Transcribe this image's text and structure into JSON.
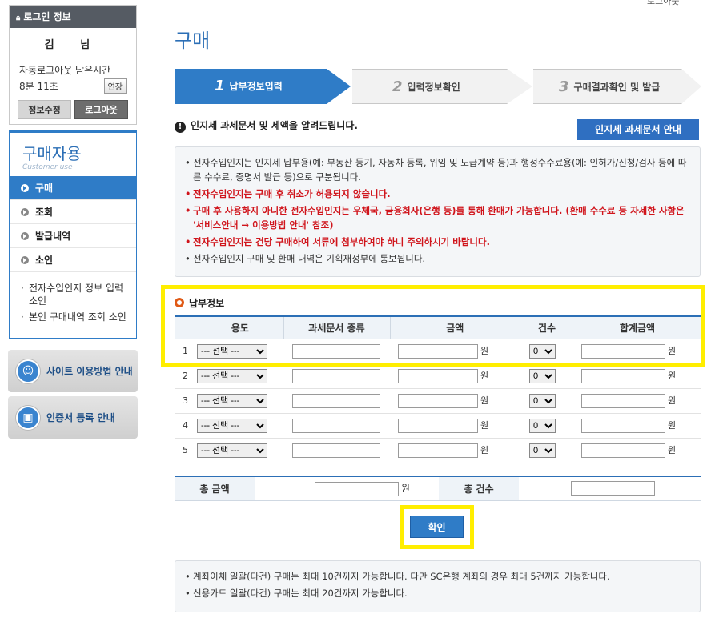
{
  "top_right": {
    "link_text": "로그아웃"
  },
  "login": {
    "header": "로그인 정보",
    "user_name": "김 님",
    "auto_logout_label": "자동로그아웃 남은시간",
    "remaining_time": "8분 11초",
    "extend_label": "연장",
    "edit_info_label": "정보수정",
    "logout_label": "로그아웃"
  },
  "side_nav": {
    "title": "구매자용",
    "subtitle": "Customer use",
    "items": [
      {
        "label": "구매",
        "active": true
      },
      {
        "label": "조회",
        "active": false
      },
      {
        "label": "발급내역",
        "active": false
      },
      {
        "label": "소인",
        "active": false
      }
    ],
    "sub_links": [
      "전자수입인지 정보 입력 소인",
      "본인 구매내역 조회 소인"
    ]
  },
  "banners": {
    "site_guide": "사이트 이용방법 안내",
    "cert_guide": "인증서 등록 안내"
  },
  "page": {
    "title": "구매"
  },
  "steps": [
    {
      "num": "1",
      "label": "납부정보입력"
    },
    {
      "num": "2",
      "label": "입력정보확인"
    },
    {
      "num": "3",
      "label": "구매결과확인 및 발급"
    }
  ],
  "notice": {
    "heading": "인지세 과세문서 및 세액을 알려드립니다.",
    "guide_button": "인지세 과세문서 안내",
    "lines": [
      {
        "text": "전자수입인지는 인지세 납부용(예: 부동산 등기, 자동차 등록, 위임 및 도급계약 등)과 행정수수료용(예: 인허가/신청/검사 등에 따른 수수료, 증명서 발급 등)으로 구분됩니다.",
        "red": false
      },
      {
        "text": "전자수입인지는 구매 후 취소가 허용되지 않습니다.",
        "red": true
      },
      {
        "text": "구매 후 사용하지 아니한 전자수입인지는 우체국, 금융회사(은행 등)를 통해 환매가 가능합니다. (환매 수수료 등 자세한 사항은 '서비스안내 → 이용방법 안내' 참조)",
        "red": true
      },
      {
        "text": "전자수입인지는 건당 구매하여 서류에 첨부하여야 하니 주의하시기 바랍니다.",
        "red": true
      },
      {
        "text": "전자수입인지 구매 및 환매 내역은 기획재정부에 통보됩니다.",
        "red": false
      }
    ]
  },
  "payment": {
    "title": "납부정보",
    "columns": [
      "용도",
      "과세문서 종류",
      "금액",
      "건수",
      "합계금액"
    ],
    "rows": [
      {
        "no": "1",
        "use": "--- 선택 ---",
        "count": "0"
      },
      {
        "no": "2",
        "use": "--- 선택 ---",
        "count": "0"
      },
      {
        "no": "3",
        "use": "--- 선택 ---",
        "count": "0"
      },
      {
        "no": "4",
        "use": "--- 선택 ---",
        "count": "0"
      },
      {
        "no": "5",
        "use": "--- 선택 ---",
        "count": "0"
      }
    ],
    "won": "원"
  },
  "totals": {
    "amount_label": "총 금액",
    "count_label": "총 건수",
    "won": "원"
  },
  "confirm_label": "확인",
  "bottom_notes": [
    "계좌이체 일괄(다건) 구매는 최대 10건까지 가능합니다. 다만 SC은행 계좌의 경우 최대 5건까지 가능합니다.",
    "신용카드 일괄(다건) 구매는 최대 20건까지 가능합니다."
  ],
  "colors": {
    "accent": "#2f7cc7",
    "highlight": "#ffee00",
    "warning": "#d0141b"
  },
  "icons": [
    "lock-icon",
    "bullet-arrow-icon",
    "exclamation-icon",
    "headset-icon",
    "certificate-lock-icon",
    "radio-ring-icon"
  ]
}
